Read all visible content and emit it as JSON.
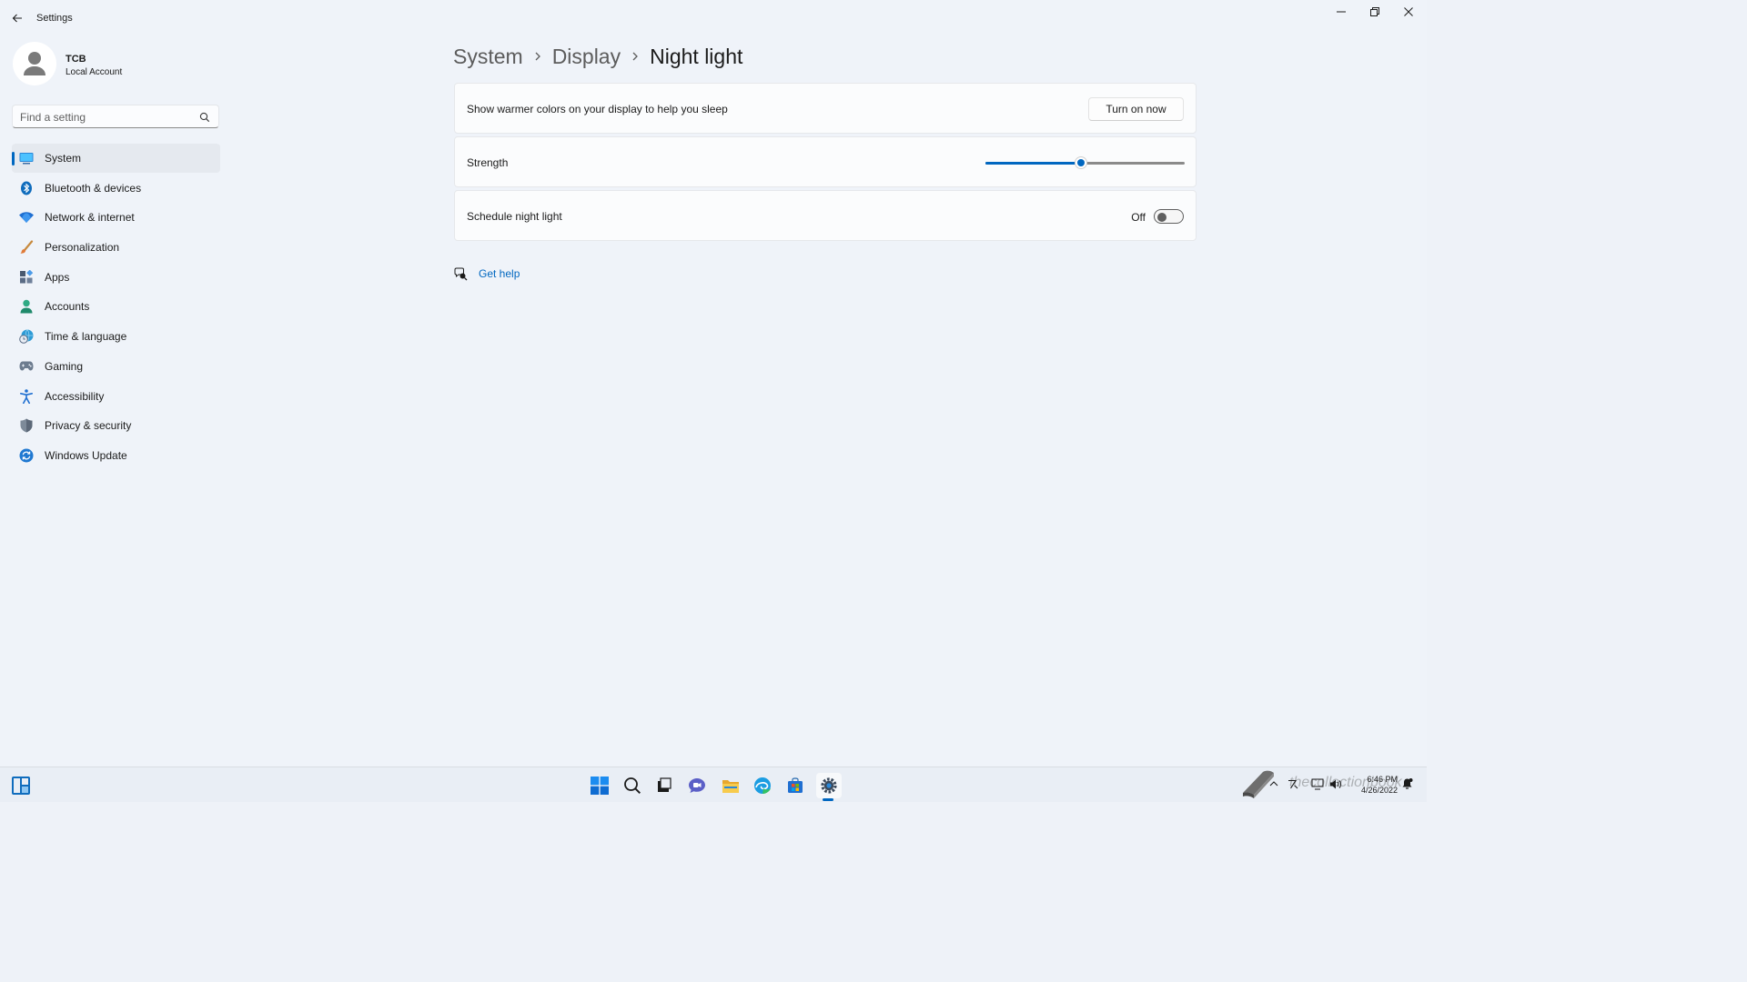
{
  "app": {
    "title": "Settings"
  },
  "user": {
    "name": "TCB",
    "account_type": "Local Account"
  },
  "search": {
    "placeholder": "Find a setting"
  },
  "sidebar": {
    "items": [
      {
        "label": "System",
        "icon": "monitor-icon",
        "active": true
      },
      {
        "label": "Bluetooth & devices",
        "icon": "bluetooth-icon",
        "active": false
      },
      {
        "label": "Network & internet",
        "icon": "wifi-icon",
        "active": false
      },
      {
        "label": "Personalization",
        "icon": "brush-icon",
        "active": false
      },
      {
        "label": "Apps",
        "icon": "apps-icon",
        "active": false
      },
      {
        "label": "Accounts",
        "icon": "person-icon",
        "active": false
      },
      {
        "label": "Time & language",
        "icon": "globe-clock-icon",
        "active": false
      },
      {
        "label": "Gaming",
        "icon": "gamepad-icon",
        "active": false
      },
      {
        "label": "Accessibility",
        "icon": "accessibility-icon",
        "active": false
      },
      {
        "label": "Privacy & security",
        "icon": "shield-icon",
        "active": false
      },
      {
        "label": "Windows Update",
        "icon": "sync-icon",
        "active": false
      }
    ]
  },
  "breadcrumb": {
    "level1": "System",
    "level2": "Display",
    "current": "Night light"
  },
  "cards": {
    "warm": {
      "label": "Show warmer colors on your display to help you sleep",
      "button": "Turn on now"
    },
    "strength": {
      "label": "Strength",
      "value_percent": 48
    },
    "schedule": {
      "label": "Schedule night light",
      "state_label": "Off",
      "on": false
    }
  },
  "help": {
    "label": "Get help"
  },
  "taskbar": {
    "time": "6:46 PM",
    "date": "4/26/2022",
    "watermark": "thecollectionbook",
    "apps": [
      "start-icon",
      "search-icon",
      "task-view-icon",
      "chat-icon",
      "file-explorer-icon",
      "edge-icon",
      "store-icon",
      "settings-icon"
    ]
  },
  "colors": {
    "accent": "#0067c0",
    "background": "#eff3f9"
  }
}
